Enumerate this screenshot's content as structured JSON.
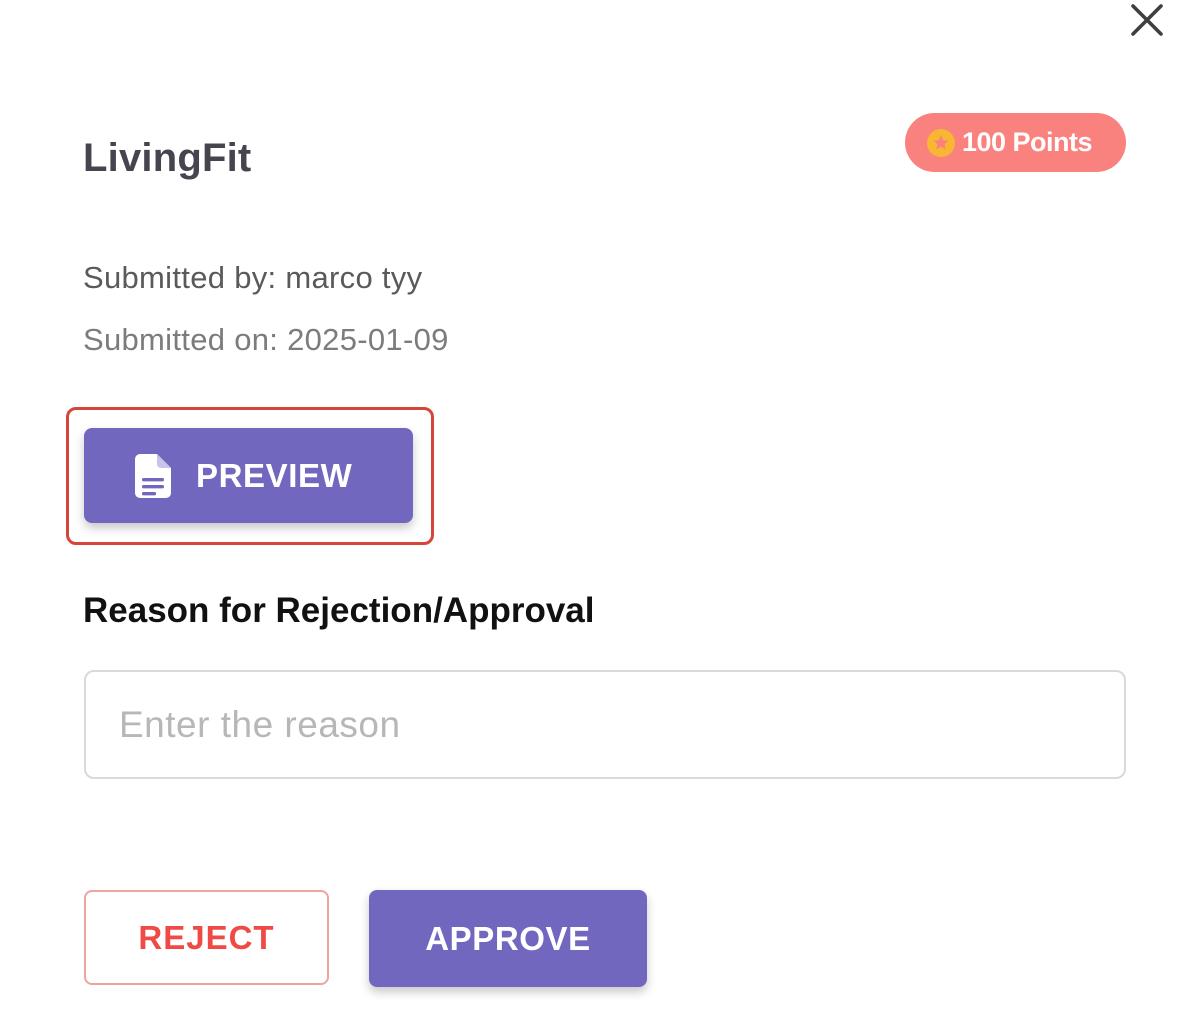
{
  "dialog": {
    "title": "LivingFit",
    "points_badge": {
      "label": "100 Points",
      "icon": "star-circle-icon",
      "color": "#f9827f"
    },
    "submitted_by": "Submitted by: marco tyy",
    "submitted_on": "Submitted on: 2025-01-09",
    "preview_button": {
      "label": "PREVIEW",
      "icon": "document-icon",
      "highlighted": true
    },
    "reason": {
      "label": "Reason for Rejection/Approval",
      "placeholder": "Enter the reason",
      "value": ""
    },
    "actions": {
      "reject_label": "REJECT",
      "approve_label": "APPROVE"
    },
    "close_icon": "close-icon"
  },
  "colors": {
    "accent": "#7267be",
    "reject": "#ef4a46",
    "highlight": "#d6453a"
  }
}
